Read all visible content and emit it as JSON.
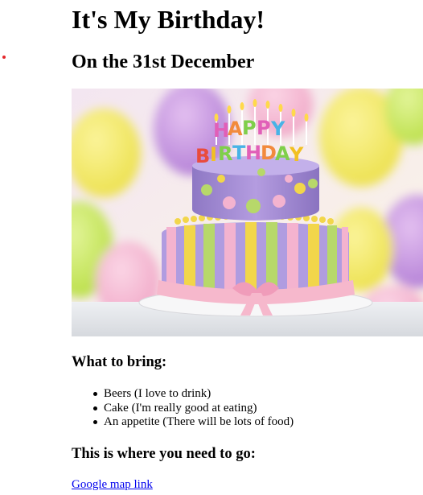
{
  "page": {
    "title": "It's My Birthday!",
    "subtitle": "On the 31st December"
  },
  "hero_image": {
    "alt": "Birthday cake",
    "cake_lettering": "HAPPY BIRTHDAY",
    "colors": {
      "cake_top": "#a88fd6",
      "stripe_pink": "#f4b3cf",
      "stripe_yellow": "#f2d64a",
      "stripe_green": "#b7d86a",
      "ribbon": "#f6b8cc"
    }
  },
  "bring": {
    "heading": "What to bring:",
    "items": [
      "Beers (I love to drink)",
      "Cake (I'm really good at eating)",
      "An appetite (There will be lots of food)"
    ]
  },
  "location": {
    "heading": "This is where you need to go:",
    "link_text": "Google map link"
  },
  "colors": {
    "link": "#0000ee",
    "marker": "#e3262a"
  }
}
